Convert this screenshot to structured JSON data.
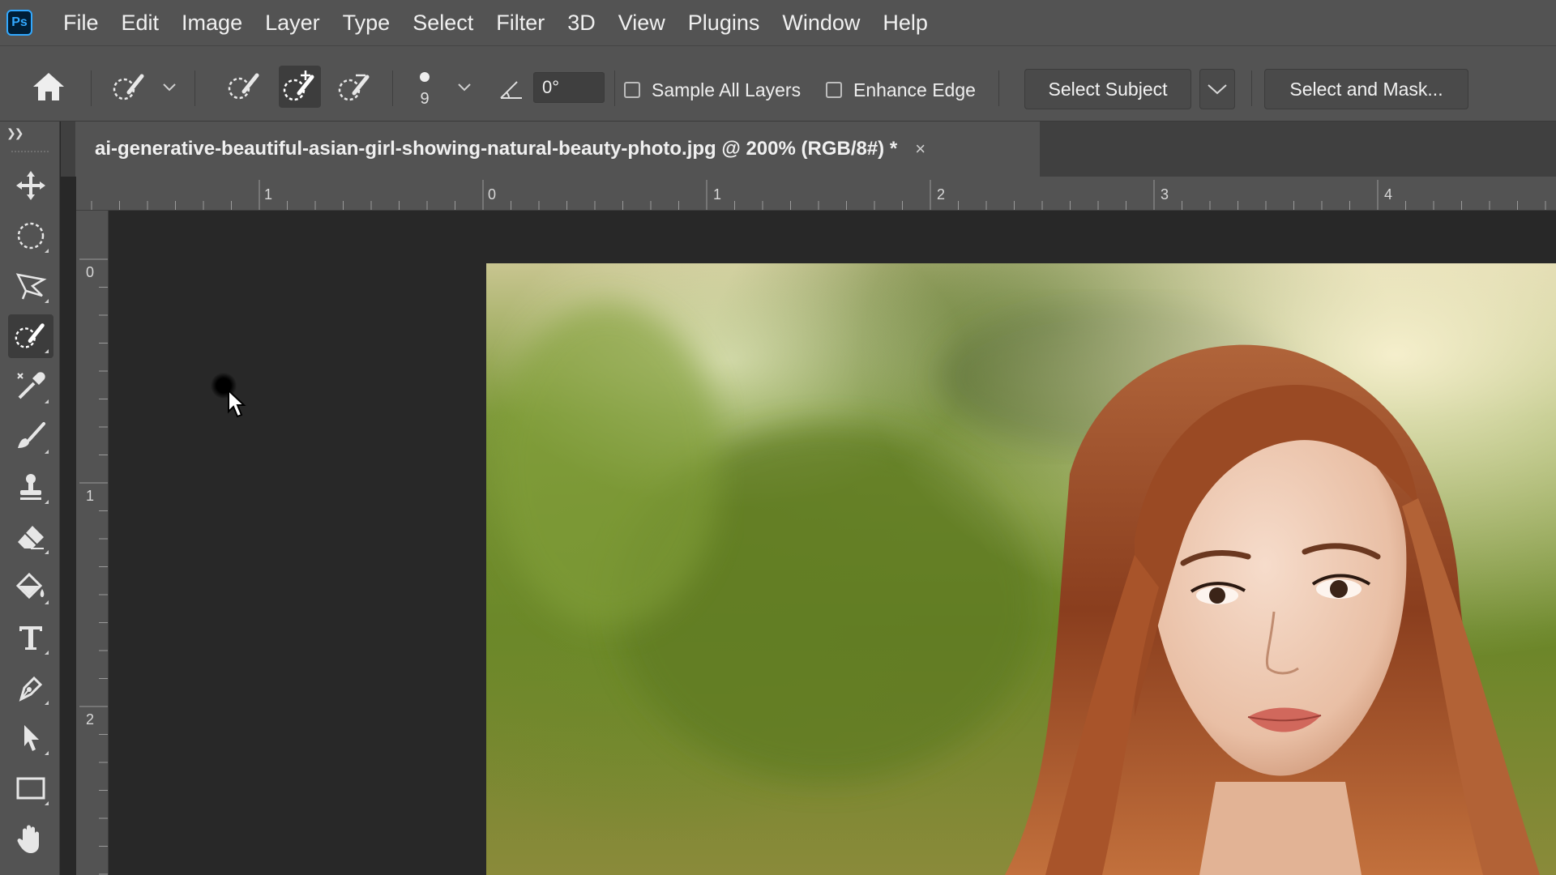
{
  "app": {
    "logo_text": "Ps",
    "accent_color": "#31a8ff"
  },
  "menu": [
    "File",
    "Edit",
    "Image",
    "Layer",
    "Type",
    "Select",
    "Filter",
    "3D",
    "View",
    "Plugins",
    "Window",
    "Help"
  ],
  "options": {
    "brush_size": "9",
    "angle_value": "0°",
    "sample_all_layers": {
      "label": "Sample All Layers",
      "checked": false
    },
    "enhance_edge": {
      "label": "Enhance Edge",
      "checked": false
    },
    "select_subject_label": "Select Subject",
    "select_and_mask_label": "Select and Mask..."
  },
  "document": {
    "tab_title": "ai-generative-beautiful-asian-girl-showing-natural-beauty-photo.jpg @ 200% (RGB/8#) *",
    "close_glyph": "×"
  },
  "ruler": {
    "horizontal_labels": [
      "1",
      "0",
      "1",
      "2",
      "3",
      "4"
    ],
    "vertical_labels": [
      "0",
      "1",
      "2"
    ]
  },
  "tools": [
    "move-tool",
    "elliptical-marquee-tool",
    "polygonal-lasso-tool",
    "quick-selection-tool",
    "spot-healing-tool",
    "brush-tool",
    "clone-stamp-tool",
    "eraser-tool",
    "paint-bucket-tool",
    "type-tool",
    "pen-tool",
    "path-selection-tool",
    "rectangle-tool",
    "hand-tool"
  ],
  "active_tool": "quick-selection-tool"
}
